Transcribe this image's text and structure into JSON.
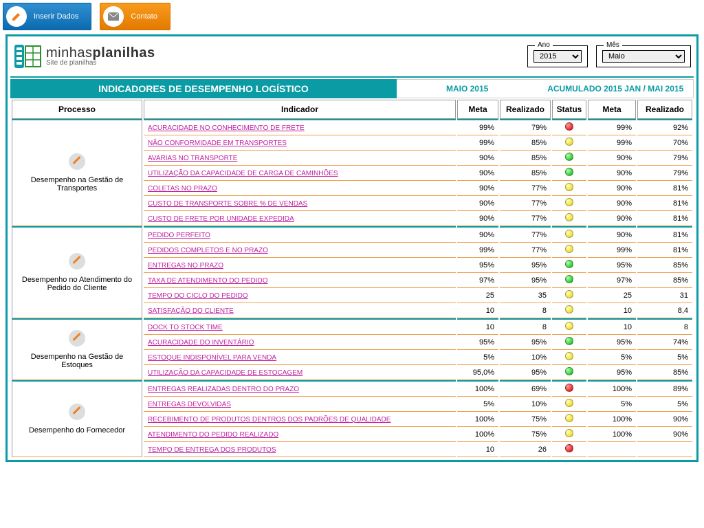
{
  "topbar": {
    "insert": "Inserir Dados",
    "contact": "Contato"
  },
  "brand": {
    "line1a": "minhas",
    "line1b": "planilhas",
    "line2": "Site de planilhas"
  },
  "filters": {
    "year_label": "Ano",
    "year_value": "2015",
    "month_label": "Mês",
    "month_value": "Maio"
  },
  "titles": {
    "main": "INDICADORES DE DESEMPENHO LOGÍSTICO",
    "mid": "MAIO 2015",
    "right": "ACUMULADO 2015 JAN / MAI 2015"
  },
  "headers": {
    "proc": "Processo",
    "ind": "Indicador",
    "meta": "Meta",
    "real": "Realizado",
    "status": "Status",
    "meta2": "Meta",
    "real2": "Realizado"
  },
  "groups": [
    {
      "process": "Desempenho na Gestão de Transportes",
      "rows": [
        {
          "ind": "ACURACIDADE NO CONHECIMENTO DE FRETE",
          "meta": "99%",
          "real": "79%",
          "status": "red",
          "meta2": "99%",
          "real2": "92%"
        },
        {
          "ind": "NÃO CONFORMIDADE EM TRANSPORTES",
          "meta": "99%",
          "real": "85%",
          "status": "yellow",
          "meta2": "99%",
          "real2": "70%"
        },
        {
          "ind": "AVARIAS NO TRANSPORTE",
          "meta": "90%",
          "real": "85%",
          "status": "green",
          "meta2": "90%",
          "real2": "79%"
        },
        {
          "ind": "UTILIZAÇÃO DA CAPACIDADE DE CARGA DE CAMINHÕES",
          "meta": "90%",
          "real": "85%",
          "status": "green",
          "meta2": "90%",
          "real2": "79%"
        },
        {
          "ind": "COLETAS NO PRAZO",
          "meta": "90%",
          "real": "77%",
          "status": "yellow",
          "meta2": "90%",
          "real2": "81%"
        },
        {
          "ind": "CUSTO DE TRANSPORTE SOBRE % DE VENDAS",
          "meta": "90%",
          "real": "77%",
          "status": "yellow",
          "meta2": "90%",
          "real2": "81%"
        },
        {
          "ind": "CUSTO DE FRETE POR UNIDADE EXPEDIDA",
          "meta": "90%",
          "real": "77%",
          "status": "yellow",
          "meta2": "90%",
          "real2": "81%"
        }
      ]
    },
    {
      "process": "Desempenho no Atendimento do Pedido do Cliente",
      "rows": [
        {
          "ind": "PEDIDO PERFEITO",
          "meta": "90%",
          "real": "77%",
          "status": "yellow",
          "meta2": "90%",
          "real2": "81%"
        },
        {
          "ind": "PEDIDOS COMPLETOS E NO PRAZO",
          "meta": "99%",
          "real": "77%",
          "status": "yellow",
          "meta2": "99%",
          "real2": "81%"
        },
        {
          "ind": "ENTREGAS NO PRAZO",
          "meta": "95%",
          "real": "95%",
          "status": "green",
          "meta2": "95%",
          "real2": "85%"
        },
        {
          "ind": "TAXA DE ATENDIMENTO DO PEDIDO",
          "meta": "97%",
          "real": "95%",
          "status": "green",
          "meta2": "97%",
          "real2": "85%"
        },
        {
          "ind": "TEMPO DO CICLO DO PEDIDO",
          "meta": "25",
          "real": "35",
          "status": "yellow",
          "meta2": "25",
          "real2": "31"
        },
        {
          "ind": "SATISFAÇÃO DO CLIENTE",
          "meta": "10",
          "real": "8",
          "status": "yellow",
          "meta2": "10",
          "real2": "8,4"
        }
      ]
    },
    {
      "process": "Desempenho na Gestão de Estoques",
      "rows": [
        {
          "ind": "DOCK TO STOCK TIME",
          "meta": "10",
          "real": "8",
          "status": "yellow",
          "meta2": "10",
          "real2": "8"
        },
        {
          "ind": "ACURACIDADE DO INVENTÁRIO",
          "meta": "95%",
          "real": "95%",
          "status": "green",
          "meta2": "95%",
          "real2": "74%"
        },
        {
          "ind": "ESTOQUE INDISPONÍVEL PARA VENDA",
          "meta": "5%",
          "real": "10%",
          "status": "yellow",
          "meta2": "5%",
          "real2": "5%"
        },
        {
          "ind": "UTILIZAÇÃO DA CAPACIDADE DE ESTOCAGEM",
          "meta": "95,0%",
          "real": "95%",
          "status": "green",
          "meta2": "95%",
          "real2": "85%"
        }
      ]
    },
    {
      "process": "Desempenho do Fornecedor",
      "rows": [
        {
          "ind": "ENTREGAS REALIZADAS DENTRO DO PRAZO",
          "meta": "100%",
          "real": "69%",
          "status": "red",
          "meta2": "100%",
          "real2": "89%"
        },
        {
          "ind": "ENTREGAS DEVOLVIDAS",
          "meta": "5%",
          "real": "10%",
          "status": "yellow",
          "meta2": "5%",
          "real2": "5%"
        },
        {
          "ind": "RECEBIMENTO DE PRODUTOS DENTROS DOS PADRÕES DE QUALIDADE",
          "meta": "100%",
          "real": "75%",
          "status": "yellow",
          "meta2": "100%",
          "real2": "90%"
        },
        {
          "ind": "ATENDIMENTO DO PEDIDO REALIZADO",
          "meta": "100%",
          "real": "75%",
          "status": "yellow",
          "meta2": "100%",
          "real2": "90%"
        },
        {
          "ind": "TEMPO DE ENTREGA DOS PRODUTOS",
          "meta": "10",
          "real": "26",
          "status": "red",
          "meta2": "",
          "real2": ""
        }
      ]
    }
  ]
}
